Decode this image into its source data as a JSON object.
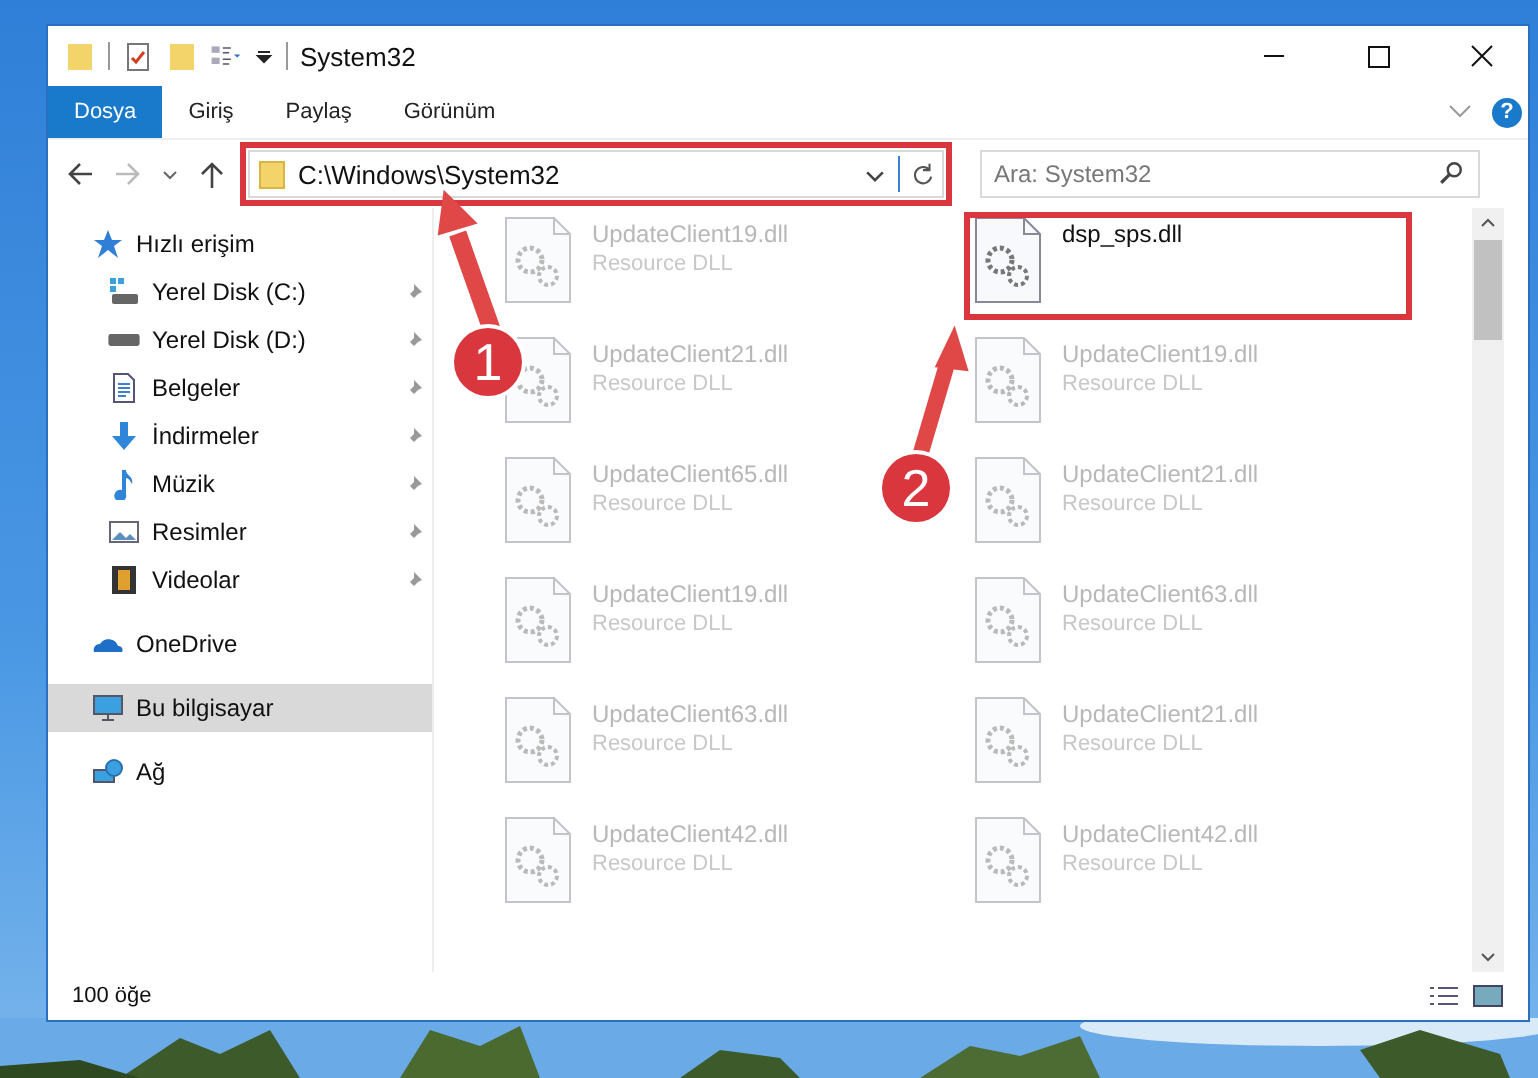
{
  "window": {
    "title": "System32"
  },
  "tabs": [
    {
      "label": "Dosya",
      "selected": true
    },
    {
      "label": "Giriş",
      "selected": false
    },
    {
      "label": "Paylaş",
      "selected": false
    },
    {
      "label": "Görünüm",
      "selected": false
    }
  ],
  "help": "?",
  "address": {
    "path": "C:\\Windows\\System32"
  },
  "search": {
    "placeholder": "Ara: System32"
  },
  "sidebar": {
    "items": [
      {
        "label": "Hızlı erişim",
        "kind": "star",
        "selected": false,
        "children": [
          {
            "label": "Yerel Disk (C:)",
            "kind": "windrive",
            "pinned": true,
            "selected": false
          },
          {
            "label": "Yerel Disk (D:)",
            "kind": "drive",
            "pinned": true,
            "selected": false
          },
          {
            "label": "Belgeler",
            "kind": "doc",
            "pinned": true,
            "selected": false
          },
          {
            "label": "İndirmeler",
            "kind": "download",
            "pinned": true,
            "selected": false
          },
          {
            "label": "Müzik",
            "kind": "music",
            "pinned": true,
            "selected": false
          },
          {
            "label": "Resimler",
            "kind": "pictures",
            "pinned": true,
            "selected": false
          },
          {
            "label": "Videolar",
            "kind": "videos",
            "pinned": true,
            "selected": false
          }
        ]
      },
      {
        "label": "OneDrive",
        "kind": "cloud",
        "selected": false
      },
      {
        "label": "Bu bilgisayar",
        "kind": "pc",
        "selected": true
      },
      {
        "label": "Ağ",
        "kind": "network",
        "selected": false
      }
    ]
  },
  "files": [
    {
      "name": "UpdateClient19.dll",
      "type": "Resource DLL",
      "blurred": true,
      "highlighted": false
    },
    {
      "name": "dsp_sps.dll",
      "blurred": false,
      "highlighted": true
    },
    {
      "name": "UpdateClient21.dll",
      "type": "Resource DLL",
      "blurred": true,
      "highlighted": false
    },
    {
      "name": "UpdateClient19.dll",
      "type": "Resource DLL",
      "blurred": true,
      "highlighted": false
    },
    {
      "name": "UpdateClient65.dll",
      "type": "Resource DLL",
      "blurred": true,
      "highlighted": false
    },
    {
      "name": "UpdateClient21.dll",
      "type": "Resource DLL",
      "blurred": true,
      "highlighted": false
    },
    {
      "name": "UpdateClient19.dll",
      "type": "Resource DLL",
      "blurred": true,
      "highlighted": false
    },
    {
      "name": "UpdateClient63.dll",
      "type": "Resource DLL",
      "blurred": true,
      "highlighted": false
    },
    {
      "name": "UpdateClient63.dll",
      "type": "Resource DLL",
      "blurred": true,
      "highlighted": false
    },
    {
      "name": "UpdateClient21.dll",
      "type": "Resource DLL",
      "blurred": true,
      "highlighted": false
    },
    {
      "name": "UpdateClient42.dll",
      "type": "Resource DLL",
      "blurred": true,
      "highlighted": false
    },
    {
      "name": "UpdateClient42.dll",
      "type": "Resource DLL",
      "blurred": true,
      "highlighted": false
    }
  ],
  "address_highlighted": true,
  "annotations": [
    {
      "number": "1"
    },
    {
      "number": "2"
    }
  ],
  "status_bar": {
    "count": "100 öğe"
  }
}
